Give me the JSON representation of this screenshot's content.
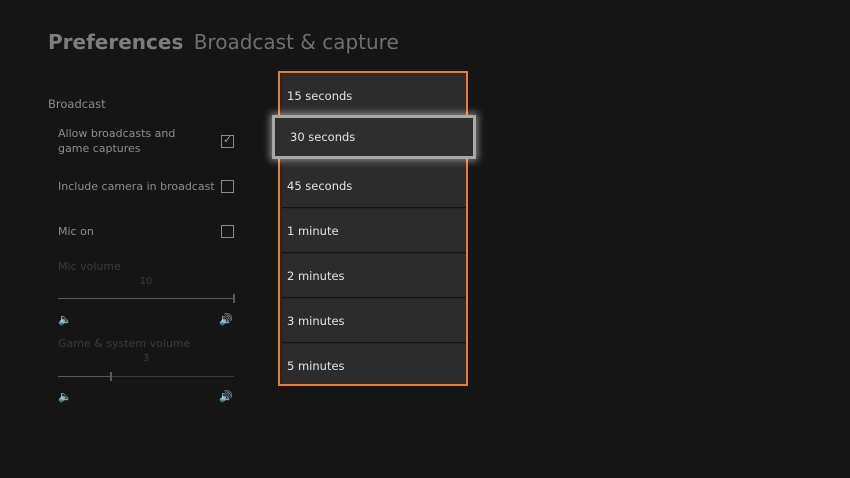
{
  "header": {
    "title_bold": "Preferences",
    "title_light": "Broadcast & capture"
  },
  "broadcast": {
    "section_label": "Broadcast",
    "settings": [
      {
        "label": "Allow broadcasts and game captures",
        "checked": true
      },
      {
        "label": "Include camera in broadcast",
        "checked": false
      },
      {
        "label": "Mic on",
        "checked": false
      }
    ],
    "check_glyph": "✓",
    "mic_volume": {
      "label": "Mic volume",
      "value": "10",
      "level": 1.0
    },
    "game_volume": {
      "label": "Game & system volume",
      "value": "3",
      "level": 0.3
    },
    "volume_low_glyph": "🔈",
    "volume_high_glyph": "🔊"
  },
  "dropdown": {
    "accent_color": "#f07a2a",
    "options": [
      "15 seconds",
      "30 seconds",
      "45 seconds",
      "1 minute",
      "2 minutes",
      "3 minutes",
      "5 minutes"
    ],
    "selected_index": 1
  }
}
